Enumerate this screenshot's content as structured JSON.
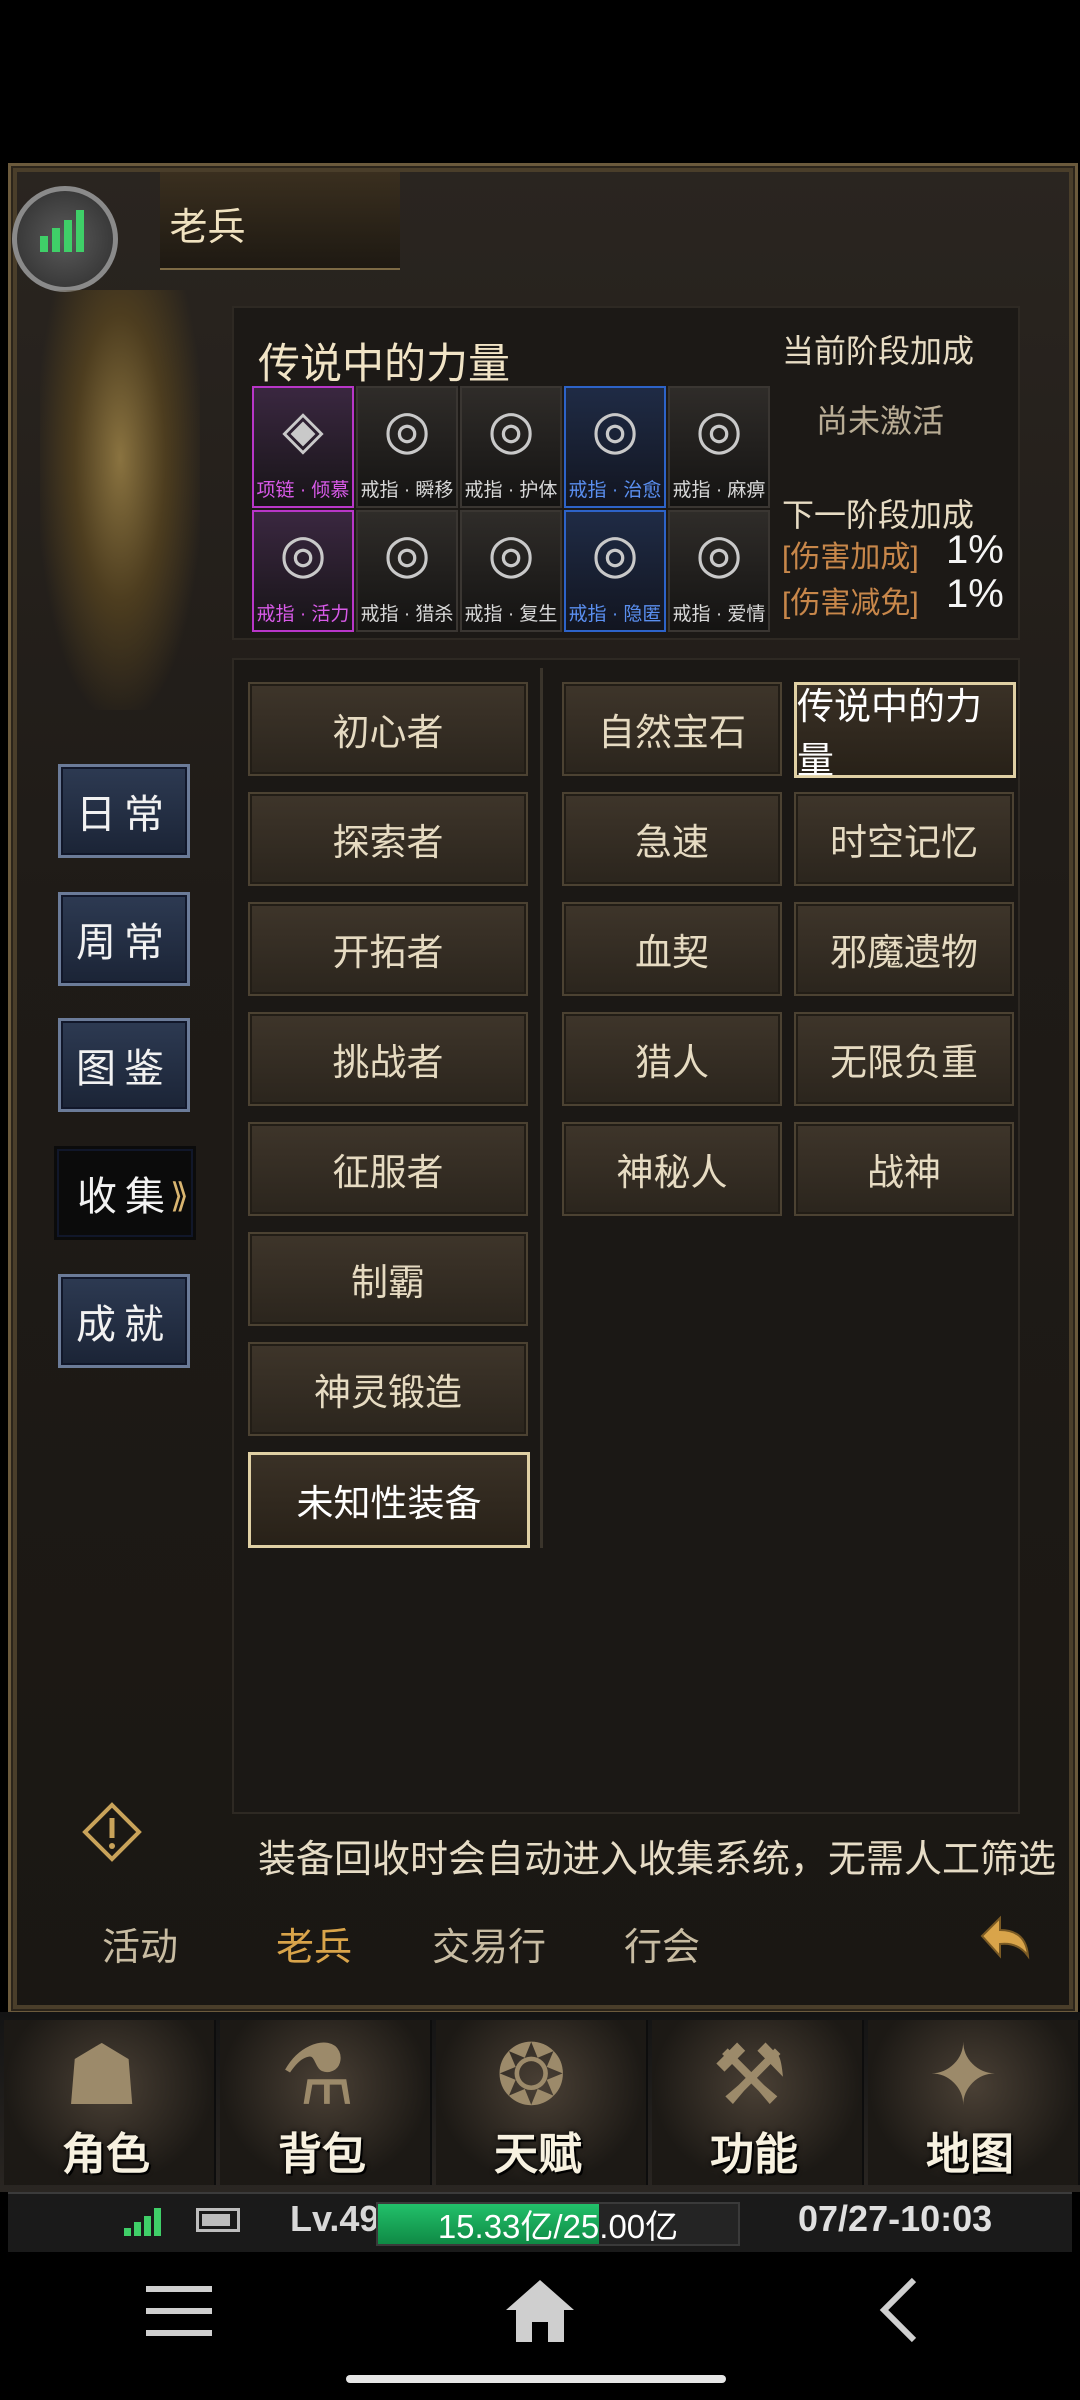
{
  "window": {
    "title": "老兵"
  },
  "sidebar": {
    "items": [
      {
        "label": "日常"
      },
      {
        "label": "周常"
      },
      {
        "label": "图鉴"
      },
      {
        "label": "收集",
        "active": true
      },
      {
        "label": "成就"
      }
    ]
  },
  "collection": {
    "title": "传说中的力量",
    "items": [
      {
        "label": "项链 · 倾慕",
        "rarity": "purple",
        "icon": "necklace-icon"
      },
      {
        "label": "戒指 · 瞬移",
        "rarity": "normal",
        "icon": "ring-icon"
      },
      {
        "label": "戒指 · 护体",
        "rarity": "normal",
        "icon": "ring-icon"
      },
      {
        "label": "戒指 · 治愈",
        "rarity": "blue",
        "icon": "ring-icon"
      },
      {
        "label": "戒指 · 麻痹",
        "rarity": "normal",
        "icon": "ring-icon"
      },
      {
        "label": "戒指 · 活力",
        "rarity": "purple",
        "icon": "ring-icon"
      },
      {
        "label": "戒指 · 猎杀",
        "rarity": "normal",
        "icon": "ring-icon"
      },
      {
        "label": "戒指 · 复生",
        "rarity": "normal",
        "icon": "ring-icon"
      },
      {
        "label": "戒指 · 隐匿",
        "rarity": "blue",
        "icon": "ring-icon"
      },
      {
        "label": "戒指 · 爱情",
        "rarity": "normal",
        "icon": "ring-icon"
      }
    ],
    "current_stage_label": "当前阶段加成",
    "current_stage_value": "尚未激活",
    "next_stage_label": "下一阶段加成",
    "next_bonuses": [
      {
        "name": "[伤害加成]",
        "value": "1%"
      },
      {
        "name": "[伤害减免]",
        "value": "1%"
      }
    ]
  },
  "categories": {
    "left": [
      "初心者",
      "探索者",
      "开拓者",
      "挑战者",
      "征服者",
      "制霸",
      "神灵锻造",
      "未知性装备"
    ],
    "right_a": [
      "自然宝石",
      "急速",
      "血契",
      "猎人",
      "神秘人"
    ],
    "right_b": [
      "传说中的力量",
      "时空记忆",
      "邪魔遗物",
      "无限负重",
      "战神"
    ],
    "selected": [
      "未知性装备",
      "传说中的力量"
    ]
  },
  "tip": {
    "text": "装备回收时会自动进入收集系统，无需人工筛选"
  },
  "bottom_tabs": [
    "活动",
    "老兵",
    "交易行",
    "行会"
  ],
  "active_bottom_tab": "老兵",
  "icon_bar": [
    "角色",
    "背包",
    "天赋",
    "功能",
    "地图"
  ],
  "status": {
    "level": "Lv.49",
    "exp_text": "15.33亿/25.00亿",
    "exp_fraction": 0.613,
    "clock": "07/27-10:03"
  },
  "colors": {
    "accent_gold": "#d9a44a",
    "exp_green": "#22c06a",
    "purple_rarity": "#b836c8",
    "blue_rarity": "#2d63c8"
  }
}
